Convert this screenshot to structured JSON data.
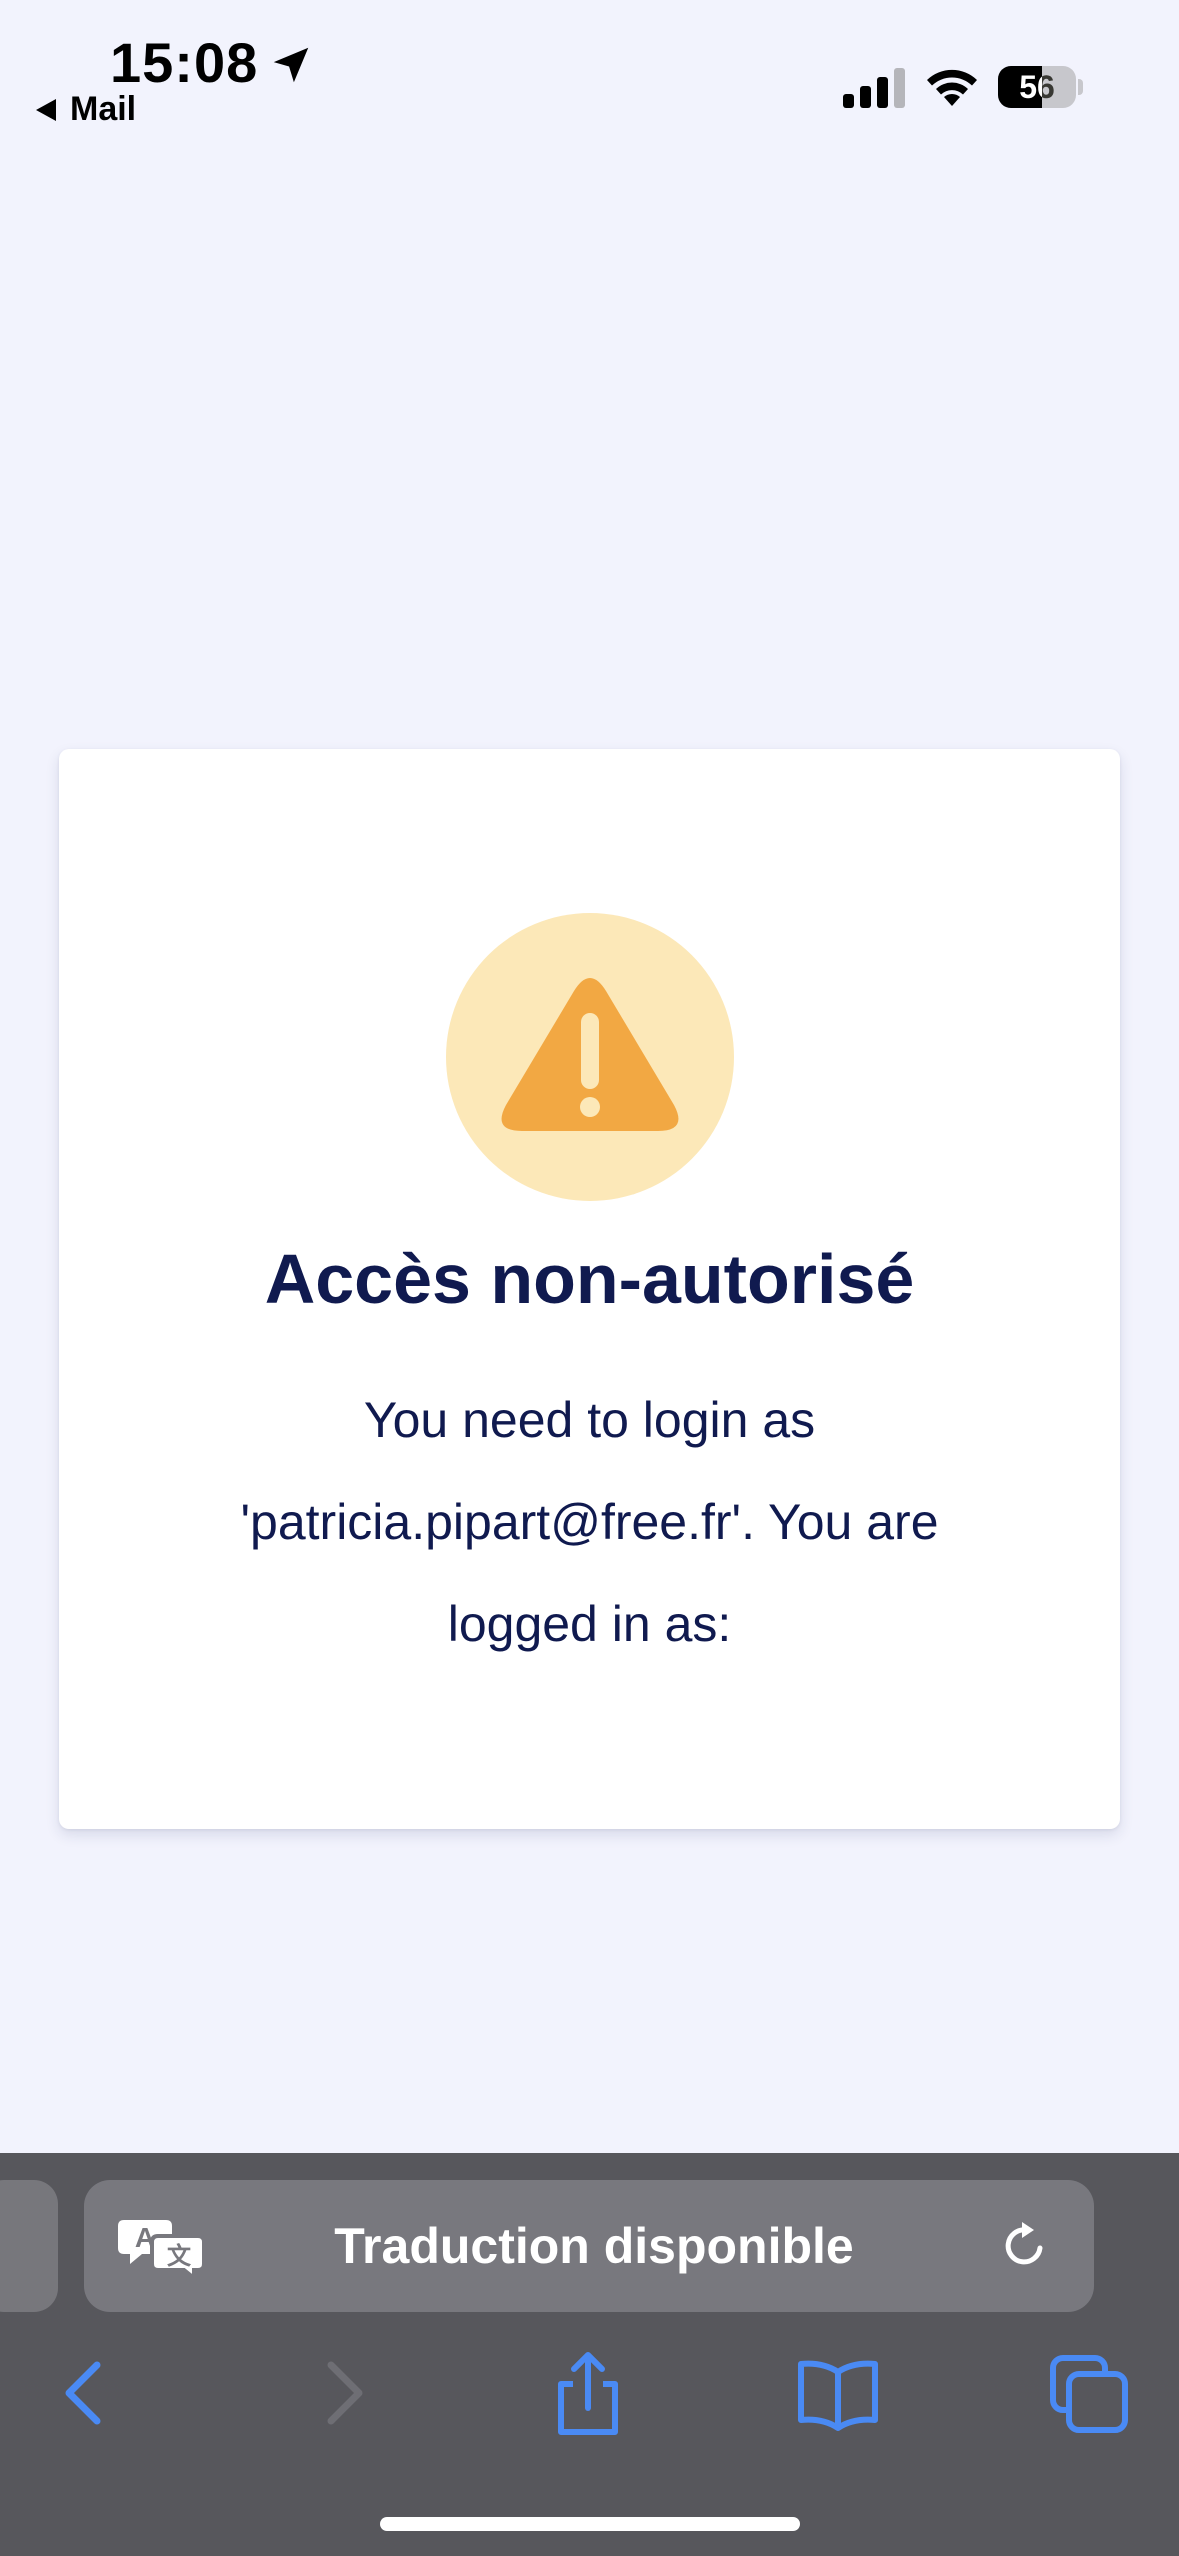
{
  "status_bar": {
    "time": "15:08",
    "back_app": "Mail",
    "battery_percent": "56",
    "battery_level": 0.56
  },
  "card": {
    "title": "Accès non-autorisé",
    "message": "You need to login as 'patricia.pipart@free.fr'. You are logged in as:",
    "icon": "warning-triangle-icon"
  },
  "toolbar": {
    "address_text": "Traduction disponible",
    "icons": [
      "translate-icon",
      "reload-icon",
      "back-icon",
      "forward-icon",
      "share-icon",
      "bookmarks-icon",
      "tabs-icon"
    ]
  },
  "colors": {
    "page_background": "#f2f3fd",
    "text": "#101a4f",
    "warning_circle": "#fce8b8",
    "warning_triangle": "#f2a843",
    "toolbar": "#57575c",
    "accent_blue": "#4a8af4"
  }
}
